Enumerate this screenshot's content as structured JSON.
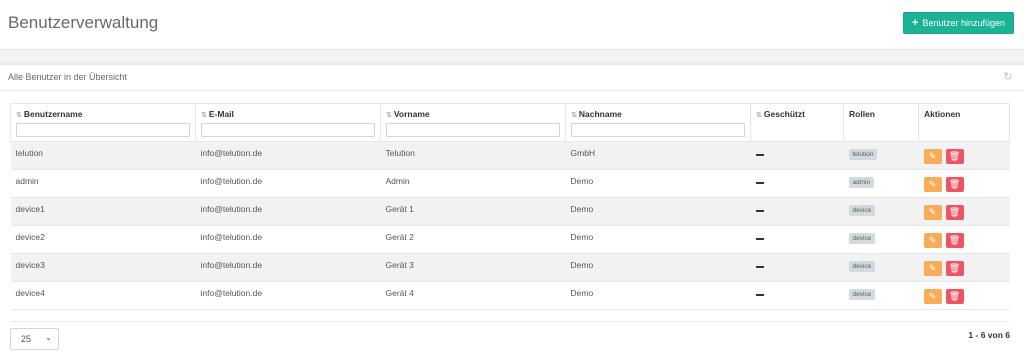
{
  "header": {
    "title": "Benutzerverwaltung",
    "add_button_label": "Benutzer hinzufügen",
    "accent_color": "#1ab394"
  },
  "panel": {
    "title": "Alle Benutzer in der Übersicht",
    "refresh_icon": "refresh-icon"
  },
  "table": {
    "columns": [
      "Benutzername",
      "E-Mail",
      "Vorname",
      "Nachname",
      "Geschützt",
      "Rollen",
      "Aktionen"
    ],
    "rows": [
      {
        "username": "telution",
        "email": "info@telution.de",
        "firstname": "Telution",
        "lastname": "GmbH",
        "role": "telution"
      },
      {
        "username": "admin",
        "email": "info@telution.de",
        "firstname": "Admin",
        "lastname": "Demo",
        "role": "admin"
      },
      {
        "username": "device1",
        "email": "info@telution.de",
        "firstname": "Gerät 1",
        "lastname": "Demo",
        "role": "device"
      },
      {
        "username": "device2",
        "email": "info@telution.de",
        "firstname": "Gerät 2",
        "lastname": "Demo",
        "role": "device"
      },
      {
        "username": "device3",
        "email": "info@telution.de",
        "firstname": "Gerät 3",
        "lastname": "Demo",
        "role": "device"
      },
      {
        "username": "device4",
        "email": "info@telution.de",
        "firstname": "Gerät 4",
        "lastname": "Demo",
        "role": "device"
      }
    ],
    "edit_icon": "edit-icon",
    "delete_icon": "trash-icon",
    "edit_color": "#f8ac59",
    "delete_color": "#ed5565"
  },
  "footer": {
    "page_size": "25",
    "pagination": "1 - 6 von 6"
  }
}
